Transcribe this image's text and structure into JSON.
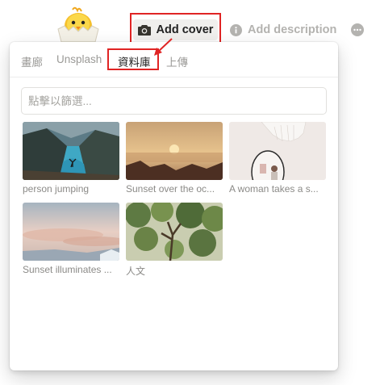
{
  "header": {
    "add_cover_label": "Add cover",
    "add_description_label": "Add description"
  },
  "tabs": [
    {
      "label": "畫廊"
    },
    {
      "label": "Unsplash"
    },
    {
      "label": "資料庫"
    },
    {
      "label": "上傳"
    }
  ],
  "search": {
    "placeholder": "點擊以篩選..."
  },
  "images": [
    {
      "caption": "person jumping"
    },
    {
      "caption": "Sunset over the oc..."
    },
    {
      "caption": "A woman takes a s..."
    },
    {
      "caption": "Sunset illuminates ..."
    },
    {
      "caption": "人文"
    }
  ]
}
